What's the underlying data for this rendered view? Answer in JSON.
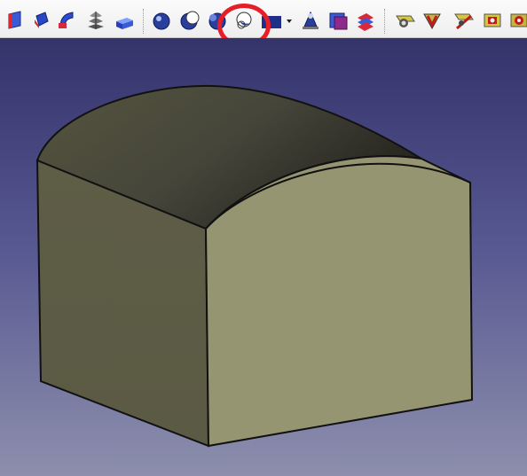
{
  "app": {
    "window_title": ""
  },
  "toolbar": {
    "buttons": [
      {
        "name": "part-face-icon",
        "group": 1
      },
      {
        "name": "part-extrude-icon",
        "group": 1
      },
      {
        "name": "part-revolve-icon",
        "group": 1
      },
      {
        "name": "part-loft-icon",
        "group": 1
      },
      {
        "name": "part-box-icon",
        "group": 1
      },
      {
        "name": "boolean-icon",
        "group": 2
      },
      {
        "name": "boolean-cut-icon",
        "group": 2
      },
      {
        "name": "boolean-fuse-icon",
        "group": 2
      },
      {
        "name": "boolean-common-icon",
        "group": 2
      },
      {
        "name": "compound-dropdown-icon",
        "group": 2
      },
      {
        "name": "part-chamfer-icon",
        "group": 2
      },
      {
        "name": "part-mirror-icon",
        "group": 2
      },
      {
        "name": "part-fillet-icon",
        "group": 2
      },
      {
        "name": "measure-linear-icon",
        "group": 3
      },
      {
        "name": "measure-angular-icon",
        "group": 3
      },
      {
        "name": "measure-refresh-icon",
        "group": 3
      },
      {
        "name": "measure-clear-icon",
        "group": 3
      },
      {
        "name": "measure-toggle-3d-icon",
        "group": 3
      }
    ],
    "highlighted_button": "boolean-common-icon"
  },
  "viewport": {
    "background_top": "#34336a",
    "background_bottom": "#8d8fad",
    "object": {
      "name": "rounded-top-box",
      "front_face_color": "#969571",
      "side_face_color": "#5f5e47",
      "top_face_dark": "#2e2e26",
      "top_face_light": "#56553f",
      "edge_color": "#111111"
    }
  },
  "annotation": {
    "circle_color": "#e61e28"
  }
}
